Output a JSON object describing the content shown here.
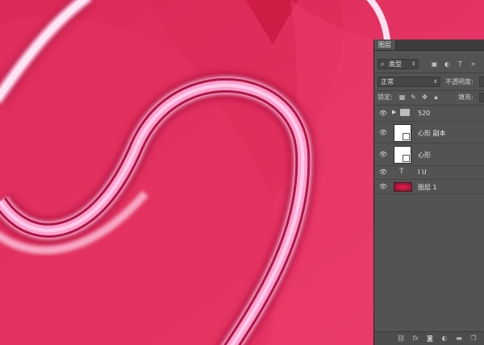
{
  "panel": {
    "tab_label": "图层",
    "filter": {
      "selected": "类型",
      "search_icon": "search-icon",
      "dropdown_icon": "updown-arrow-icon"
    },
    "filter_icons": [
      "image-filter-icon",
      "adjustment-filter-icon",
      "type-filter-icon",
      "shape-filter-icon"
    ],
    "blend_mode": {
      "value": "正常"
    },
    "opacity": {
      "label": "不透明度:"
    },
    "lock": {
      "label": "锁定:"
    },
    "fill": {
      "label": "填充:"
    },
    "layers": [
      {
        "name": "520",
        "kind": "group"
      },
      {
        "name": "心形 副本",
        "kind": "shape"
      },
      {
        "name": "心形",
        "kind": "shape"
      },
      {
        "name": "I U",
        "kind": "text"
      },
      {
        "name": "图层 1",
        "kind": "pixel"
      }
    ],
    "footer_icons": [
      "link-icon",
      "fx-icon",
      "mask-icon",
      "adjustment-icon",
      "group-folder-icon",
      "new-layer-icon"
    ]
  },
  "colors": {
    "canvas_pink": "#e5305f",
    "heart_dark": "#d01c45",
    "outline_pink": "#ff9fd0",
    "panel_gray": "#535353",
    "layer_thumb_red": "#c0123a"
  }
}
